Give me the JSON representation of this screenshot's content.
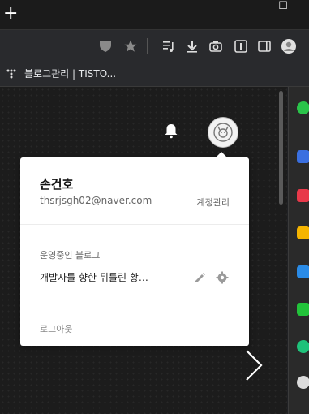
{
  "titlebar": {
    "new_tab": "+",
    "minimize": "—",
    "maximize": "☐"
  },
  "toolbar": {
    "icons": [
      "shield-icon",
      "star-icon",
      "playlist-icon",
      "download-icon",
      "camera-icon",
      "info-icon",
      "sidebar-icon",
      "profile-icon"
    ]
  },
  "bookmarks": {
    "item": "블로그관리 | TISTO..."
  },
  "header": {
    "bell_icon": "bell-icon",
    "avatar_icon": "avatar-icon"
  },
  "popup": {
    "name": "손건호",
    "email": "thsrjsgh02@naver.com",
    "manage": "계정관리",
    "section_title": "운영중인 블로그",
    "blog_name": "개발자를 향한 뒤틀린 황…",
    "logout": "로그아웃"
  },
  "colors": {
    "popup_bg": "#ffffff",
    "page_bg": "#1c1c1c",
    "toolbar_bg": "#292a2d"
  }
}
